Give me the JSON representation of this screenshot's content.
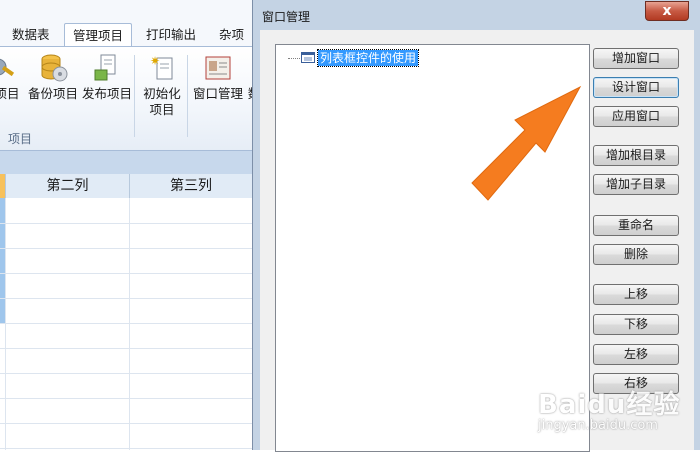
{
  "app": {
    "tabs": [
      "数据表",
      "管理项目",
      "打印输出",
      "杂项"
    ],
    "active_tab": "管理项目",
    "ribbon_buttons": [
      "项目",
      "备份项目",
      "发布项目",
      "初始化",
      "项目",
      "窗口管理",
      "数"
    ],
    "group_label": "项目",
    "grid_headers": [
      "第二列",
      "第三列"
    ]
  },
  "dialog": {
    "title": "窗口管理",
    "close_label": "x",
    "tree": {
      "root_label": "列表框控件的使用"
    },
    "buttons": {
      "add_window": "增加窗口",
      "design_window": "设计窗口",
      "apply_window": "应用窗口",
      "add_root_dir": "增加根目录",
      "add_sub_dir": "增加子目录",
      "rename": "重命名",
      "delete": "删除",
      "move_up": "上移",
      "move_down": "下移",
      "move_left": "左移",
      "move_right": "右移"
    }
  },
  "watermark": {
    "brand": "Baidu经验",
    "url": "jingyan.baidu.com"
  },
  "colors": {
    "arrow": "#f57c1f",
    "selection": "#3399ff",
    "close_button": "#c75a44"
  }
}
